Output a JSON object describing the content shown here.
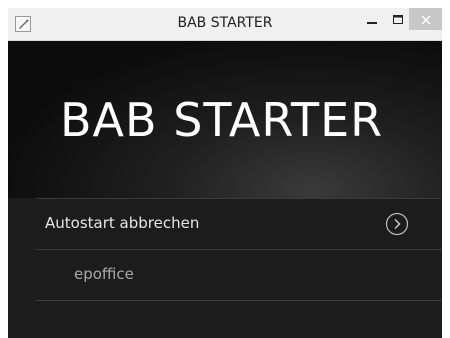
{
  "window": {
    "title": "BAB STARTER"
  },
  "titlebar": {
    "app_icon": "pen-icon",
    "minimize_icon": "minimize-icon",
    "maximize_icon": "maximize-icon",
    "close_icon": "close-icon"
  },
  "banner": {
    "heading": "BAB STARTER"
  },
  "menu": {
    "items": [
      {
        "label": "Autostart abbrechen",
        "icon": "chevron-right-circle-icon"
      },
      {
        "label": "epoffice"
      }
    ]
  },
  "colors": {
    "background": "#1b1b1b",
    "titlebar": "#f0f0f0",
    "close_button": "#c7c7c7",
    "text_primary": "#e6e6e6",
    "text_secondary": "#a8a8a8",
    "divider": "#3a3a3a"
  }
}
